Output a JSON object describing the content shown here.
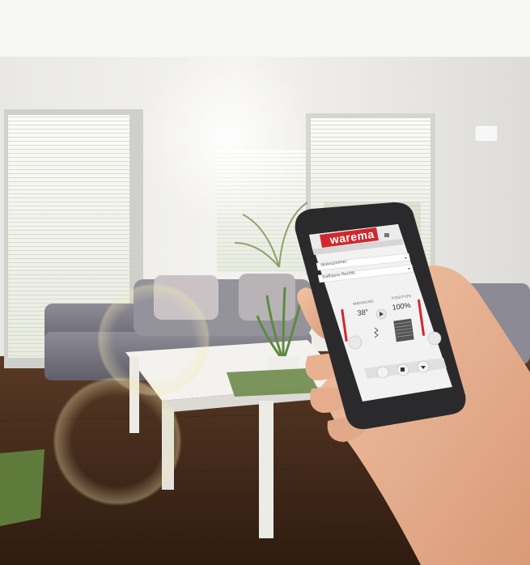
{
  "brand": {
    "logo_text": "warema",
    "logo_color": "#d1282d"
  },
  "app": {
    "dropdown_1": "Wohnzimmer",
    "dropdown_2": "Raffstore Rechts",
    "tilt_label": "WENDUNG",
    "tilt_value": "38°",
    "position_label": "POSITION",
    "position_value": "100%"
  },
  "icons": [
    "hamburger-menu-icon",
    "chevron-down-icon",
    "play-icon",
    "stop-icon",
    "up-down-icon",
    "shade-icon"
  ]
}
